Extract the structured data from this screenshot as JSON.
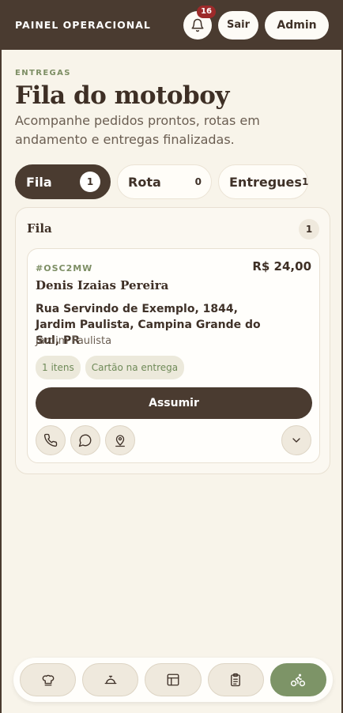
{
  "header": {
    "brand": "PAINEL OPERACIONAL",
    "notifications_count": "16",
    "logout_label": "Sair",
    "admin_label": "Admin"
  },
  "page": {
    "section_tag": "ENTREGAS",
    "title": "Fila do motoboy",
    "subtitle": "Acompanhe pedidos prontos, rotas em andamento e entregas finalizadas."
  },
  "tabs": [
    {
      "label": "Fila",
      "count": "1",
      "active": true
    },
    {
      "label": "Rota",
      "count": "0",
      "active": false
    },
    {
      "label": "Entregues",
      "count": "1",
      "active": false
    }
  ],
  "panel": {
    "title": "Fila",
    "count": "1",
    "orders": [
      {
        "code": "#OSC2MW",
        "price": "R$ 24,00",
        "customer": "Denis Izaias Pereira",
        "address": "Rua Servindo de Exemplo, 1844, Jardim Paulista, Campina Grande do Sul, PR",
        "district": "Jardim Paulista",
        "items": "1 itens",
        "payment": "Cartão na entrega",
        "action_label": "Assumir",
        "icons": [
          "phone-icon",
          "chat-icon",
          "map-pin-icon",
          "chevron-down-icon"
        ]
      }
    ]
  },
  "bottom_nav": [
    {
      "icon": "chef-hat-icon",
      "active": false
    },
    {
      "icon": "cloche-icon",
      "active": false
    },
    {
      "icon": "table-icon",
      "active": false
    },
    {
      "icon": "clipboard-icon",
      "active": false
    },
    {
      "icon": "bike-icon",
      "active": true
    }
  ],
  "colors": {
    "header_bg": "#4a3b30",
    "page_bg": "#f8f4ea",
    "accent_green": "#7d9467",
    "badge_red": "#9d2a2a"
  }
}
